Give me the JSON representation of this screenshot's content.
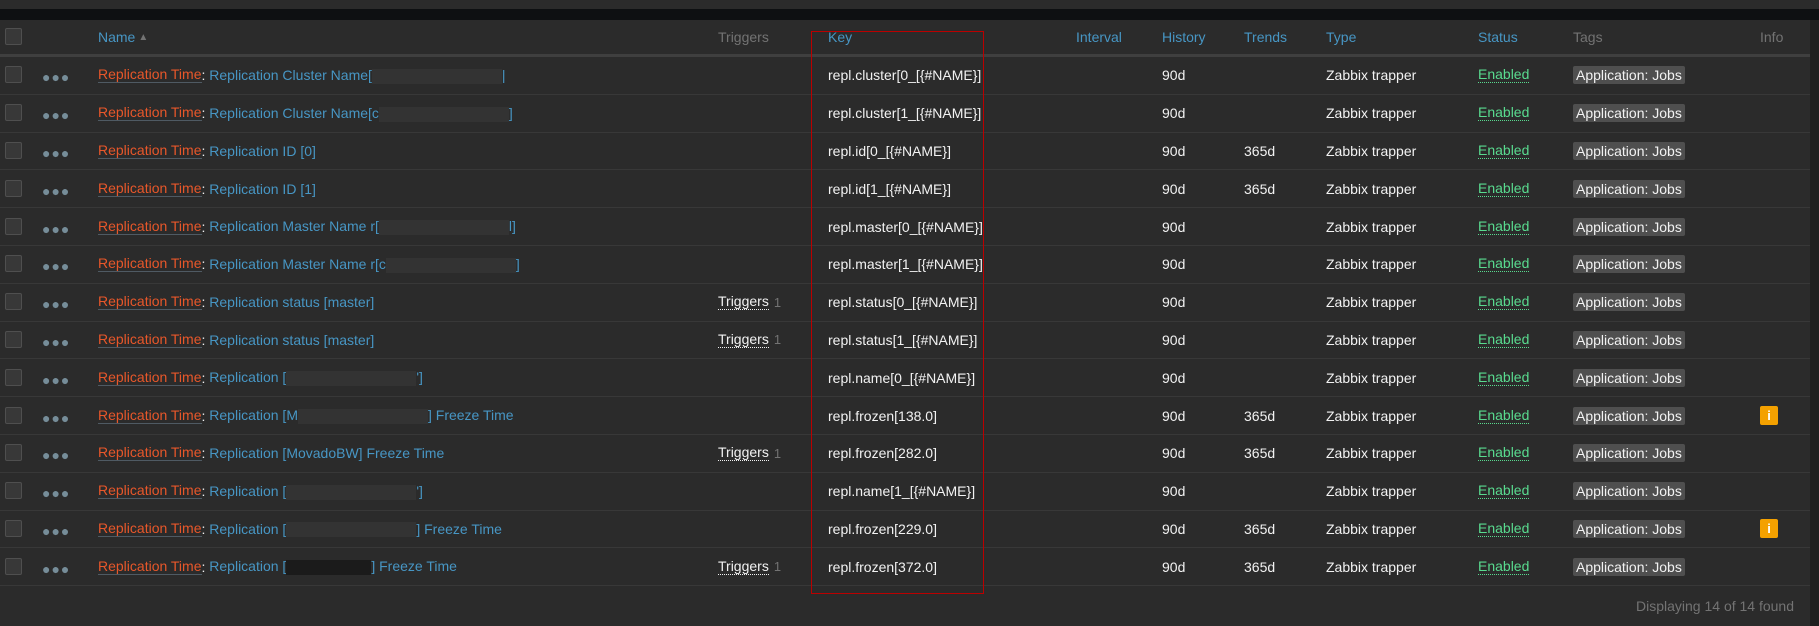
{
  "header": {
    "name": "Name",
    "sort_indicator": "▲",
    "triggers": "Triggers",
    "key": "Key",
    "interval": "Interval",
    "history": "History",
    "trends": "Trends",
    "type": "Type",
    "status": "Status",
    "tags": "Tags",
    "info": "Info"
  },
  "rows": [
    {
      "template": "Replication Time",
      "name_before": "Replication Cluster Name[",
      "redacted": true,
      "name_after": "|",
      "triggers": "",
      "triggers_count": "",
      "key": "repl.cluster[0_[{#NAME}]",
      "interval": "",
      "history": "90d",
      "trends": "",
      "type": "Zabbix trapper",
      "status": "Enabled",
      "tag": "Application: Jobs",
      "info": false
    },
    {
      "template": "Replication Time",
      "name_before": "Replication Cluster Name[c",
      "redacted": true,
      "name_after": "]",
      "triggers": "",
      "triggers_count": "",
      "key": "repl.cluster[1_[{#NAME}]",
      "interval": "",
      "history": "90d",
      "trends": "",
      "type": "Zabbix trapper",
      "status": "Enabled",
      "tag": "Application: Jobs",
      "info": false
    },
    {
      "template": "Replication Time",
      "name_before": "Replication ID [0]",
      "redacted": false,
      "name_after": "",
      "triggers": "",
      "triggers_count": "",
      "key": "repl.id[0_[{#NAME}]",
      "interval": "",
      "history": "90d",
      "trends": "365d",
      "type": "Zabbix trapper",
      "status": "Enabled",
      "tag": "Application: Jobs",
      "info": false
    },
    {
      "template": "Replication Time",
      "name_before": "Replication ID [1]",
      "redacted": false,
      "name_after": "",
      "triggers": "",
      "triggers_count": "",
      "key": "repl.id[1_[{#NAME}]",
      "interval": "",
      "history": "90d",
      "trends": "365d",
      "type": "Zabbix trapper",
      "status": "Enabled",
      "tag": "Application: Jobs",
      "info": false
    },
    {
      "template": "Replication Time",
      "name_before": "Replication Master Name r[",
      "redacted": true,
      "name_after": "l]",
      "triggers": "",
      "triggers_count": "",
      "key": "repl.master[0_[{#NAME}]",
      "interval": "",
      "history": "90d",
      "trends": "",
      "type": "Zabbix trapper",
      "status": "Enabled",
      "tag": "Application: Jobs",
      "info": false
    },
    {
      "template": "Replication Time",
      "name_before": "Replication Master Name r[c",
      "redacted": true,
      "name_after": "]",
      "triggers": "",
      "triggers_count": "",
      "key": "repl.master[1_[{#NAME}]",
      "interval": "",
      "history": "90d",
      "trends": "",
      "type": "Zabbix trapper",
      "status": "Enabled",
      "tag": "Application: Jobs",
      "info": false
    },
    {
      "template": "Replication Time",
      "name_before": "Replication status [master]",
      "redacted": false,
      "name_after": "",
      "triggers": "Triggers",
      "triggers_count": "1",
      "key": "repl.status[0_[{#NAME}]",
      "interval": "",
      "history": "90d",
      "trends": "",
      "type": "Zabbix trapper",
      "status": "Enabled",
      "tag": "Application: Jobs",
      "info": false
    },
    {
      "template": "Replication Time",
      "name_before": "Replication status [master]",
      "redacted": false,
      "name_after": "",
      "triggers": "Triggers",
      "triggers_count": "1",
      "key": "repl.status[1_[{#NAME}]",
      "interval": "",
      "history": "90d",
      "trends": "",
      "type": "Zabbix trapper",
      "status": "Enabled",
      "tag": "Application: Jobs",
      "info": false
    },
    {
      "template": "Replication Time",
      "name_before": "Replication [",
      "redacted": true,
      "name_after": "']",
      "triggers": "",
      "triggers_count": "",
      "key": "repl.name[0_[{#NAME}]",
      "interval": "",
      "history": "90d",
      "trends": "",
      "type": "Zabbix trapper",
      "status": "Enabled",
      "tag": "Application: Jobs",
      "info": false
    },
    {
      "template": "Replication Time",
      "name_before": "Replication [M",
      "redacted": true,
      "name_after": "] Freeze Time",
      "triggers": "",
      "triggers_count": "",
      "key": "repl.frozen[138.0]",
      "interval": "",
      "history": "90d",
      "trends": "365d",
      "type": "Zabbix trapper",
      "status": "Enabled",
      "tag": "Application: Jobs",
      "info": true
    },
    {
      "template": "Replication Time",
      "name_before": "Replication [MovadoBW] Freeze Time",
      "redacted": false,
      "name_after": "",
      "triggers": "Triggers",
      "triggers_count": "1",
      "key": "repl.frozen[282.0]",
      "interval": "",
      "history": "90d",
      "trends": "365d",
      "type": "Zabbix trapper",
      "status": "Enabled",
      "tag": "Application: Jobs",
      "info": false
    },
    {
      "template": "Replication Time",
      "name_before": "Replication [",
      "redacted": true,
      "name_after": "']",
      "triggers": "",
      "triggers_count": "",
      "key": "repl.name[1_[{#NAME}]",
      "interval": "",
      "history": "90d",
      "trends": "",
      "type": "Zabbix trapper",
      "status": "Enabled",
      "tag": "Application: Jobs",
      "info": false
    },
    {
      "template": "Replication Time",
      "name_before": "Replication [",
      "redacted": true,
      "name_after": "] Freeze Time",
      "triggers": "",
      "triggers_count": "",
      "key": "repl.frozen[229.0]",
      "interval": "",
      "history": "90d",
      "trends": "365d",
      "type": "Zabbix trapper",
      "status": "Enabled",
      "tag": "Application: Jobs",
      "info": true
    },
    {
      "template": "Replication Time",
      "name_before": "Replication [",
      "redacted": "black",
      "name_after": "] Freeze Time",
      "triggers": "Triggers",
      "triggers_count": "1",
      "key": "repl.frozen[372.0]",
      "interval": "",
      "history": "90d",
      "trends": "365d",
      "type": "Zabbix trapper",
      "status": "Enabled",
      "tag": "Application: Jobs",
      "info": false
    }
  ],
  "name_separator": ": ",
  "info_icon": "i",
  "footer": "Displaying 14 of 14 found"
}
